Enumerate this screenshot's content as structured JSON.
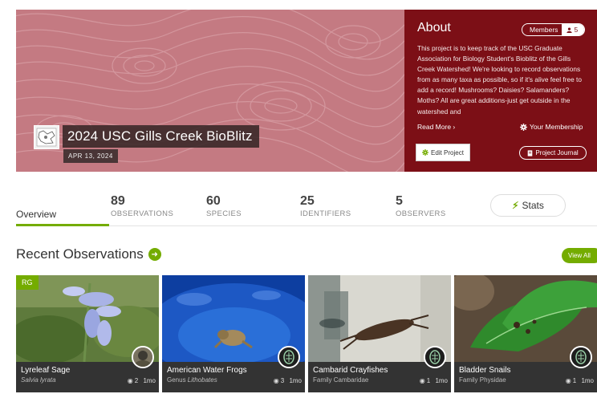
{
  "project": {
    "title": "2024 USC Gills Creek BioBlitz",
    "date": "APR 13, 2024"
  },
  "about": {
    "heading": "About",
    "members_label": "Members",
    "members_count": "5",
    "description": "This project is to keep track of the USC Graduate Association for Biology Student's Bioblitz of the Gills Creek Watershed! We're looking to record observations from as many taxa as possible, so if it's alive feel free to add a record! Mushrooms? Daisies? Salamanders? Moths? All are great additions-just get outside in the watershed and",
    "read_more": "Read More ›",
    "your_membership": "Your Membership",
    "edit_project": "Edit Project",
    "project_journal": "Project Journal"
  },
  "tabs": {
    "overview": "Overview",
    "stats_button": "Stats"
  },
  "stats": [
    {
      "value": "89",
      "label": "OBSERVATIONS"
    },
    {
      "value": "60",
      "label": "SPECIES"
    },
    {
      "value": "25",
      "label": "IDENTIFIERS"
    },
    {
      "value": "5",
      "label": "OBSERVERS"
    }
  ],
  "recent": {
    "title": "Recent Observations",
    "view_all": "View All",
    "cards": [
      {
        "name": "Lyreleaf Sage",
        "sub": "Salvia lyrata",
        "count": "2",
        "age": "1mo",
        "badge": "RG"
      },
      {
        "name": "American Water Frogs",
        "sub": "Genus Lithobates",
        "count": "3",
        "age": "1mo"
      },
      {
        "name": "Cambarid Crayfishes",
        "sub": "Family Cambaridae",
        "count": "1",
        "age": "1mo"
      },
      {
        "name": "Bladder Snails",
        "sub": "Family Physidae",
        "count": "1",
        "age": "1mo"
      }
    ]
  },
  "colors": {
    "accent": "#74ac00",
    "about_bg": "#7c0f16",
    "banner_bg": "#c47a82"
  },
  "icons": [
    "gear-icon",
    "user-icon",
    "journal-icon",
    "bolt-icon",
    "arrow-right-icon",
    "observation-icon"
  ]
}
